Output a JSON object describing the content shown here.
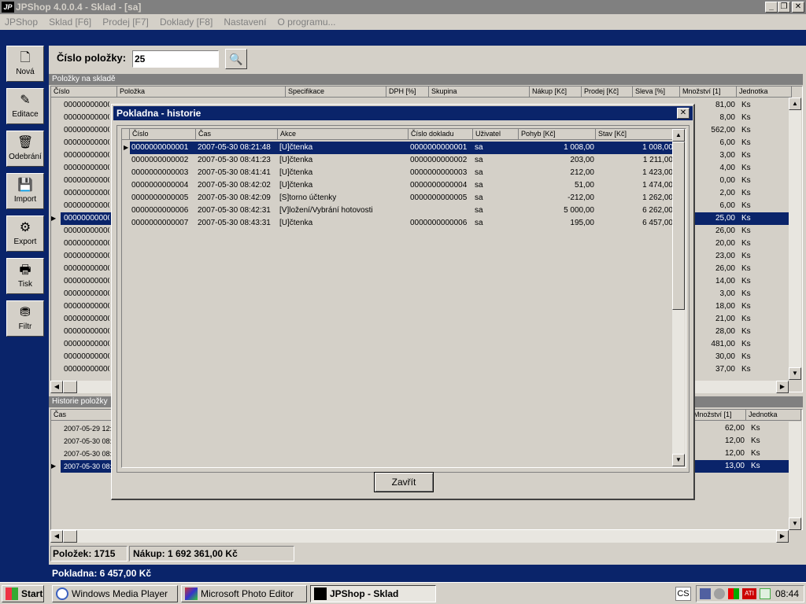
{
  "window": {
    "logo": "JP",
    "title": "JPShop 4.0.0.4 - Sklad - [sa]",
    "btn_minimize": "_",
    "btn_maximize": "❐",
    "btn_close": "✕"
  },
  "menu": [
    "JPShop",
    "Sklad [F6]",
    "Prodej [F7]",
    "Doklady [F8]",
    "Nastavení",
    "O programu..."
  ],
  "toolbar": [
    {
      "label": "Nová",
      "icon": "🗋"
    },
    {
      "label": "Editace",
      "icon": "✎"
    },
    {
      "label": "Odebrání",
      "icon": "🗑"
    },
    {
      "label": "Import",
      "icon": "💾"
    },
    {
      "label": "Export",
      "icon": "⚙"
    },
    {
      "label": "Tisk",
      "icon": "🖶"
    },
    {
      "label": "Filtr",
      "icon": "⛃"
    }
  ],
  "search": {
    "label": "Číslo položky:",
    "value": "25"
  },
  "items_panel": {
    "title": "Položky na skladě",
    "columns": [
      "Číslo",
      "Položka",
      "Specifikace",
      "DPH [%]",
      "Skupina",
      "Nákup [Kč]",
      "Prodej [Kč]",
      "Sleva [%]",
      "Množství [1]",
      "Jednotka"
    ],
    "rows": [
      {
        "cislo": "00000000000",
        "mnozstvi": "81,00",
        "jednotka": "Ks"
      },
      {
        "cislo": "00000000000",
        "mnozstvi": "8,00",
        "jednotka": "Ks"
      },
      {
        "cislo": "00000000000",
        "mnozstvi": "562,00",
        "jednotka": "Ks"
      },
      {
        "cislo": "00000000000",
        "mnozstvi": "6,00",
        "jednotka": "Ks"
      },
      {
        "cislo": "00000000000",
        "mnozstvi": "3,00",
        "jednotka": "Ks"
      },
      {
        "cislo": "00000000000",
        "mnozstvi": "4,00",
        "jednotka": "Ks"
      },
      {
        "cislo": "00000000000",
        "mnozstvi": "0,00",
        "jednotka": "Ks"
      },
      {
        "cislo": "00000000000",
        "mnozstvi": "2,00",
        "jednotka": "Ks"
      },
      {
        "cislo": "00000000000",
        "mnozstvi": "6,00",
        "jednotka": "Ks"
      },
      {
        "cislo": "00000000000",
        "mnozstvi": "25,00",
        "jednotka": "Ks",
        "selected": true
      },
      {
        "cislo": "00000000000",
        "mnozstvi": "26,00",
        "jednotka": "Ks"
      },
      {
        "cislo": "00000000000",
        "mnozstvi": "20,00",
        "jednotka": "Ks"
      },
      {
        "cislo": "00000000000",
        "mnozstvi": "23,00",
        "jednotka": "Ks"
      },
      {
        "cislo": "00000000000",
        "mnozstvi": "26,00",
        "jednotka": "Ks"
      },
      {
        "cislo": "00000000000",
        "mnozstvi": "14,00",
        "jednotka": "Ks"
      },
      {
        "cislo": "00000000000",
        "mnozstvi": "3,00",
        "jednotka": "Ks"
      },
      {
        "cislo": "00000000000",
        "mnozstvi": "18,00",
        "jednotka": "Ks"
      },
      {
        "cislo": "00000000000",
        "mnozstvi": "21,00",
        "jednotka": "Ks"
      },
      {
        "cislo": "00000000000",
        "mnozstvi": "28,00",
        "jednotka": "Ks"
      },
      {
        "cislo": "00000000000",
        "mnozstvi": "481,00",
        "jednotka": "Ks"
      },
      {
        "cislo": "00000000000",
        "mnozstvi": "30,00",
        "jednotka": "Ks"
      },
      {
        "cislo": "00000000000",
        "mnozstvi": "37,00",
        "jednotka": "Ks"
      }
    ]
  },
  "history_panel": {
    "title": "Historie položky",
    "columns": [
      "Čas",
      "Množství [1]",
      "Jednotka"
    ],
    "rows": [
      {
        "cas": "2007-05-29 12:",
        "mnozstvi": "62,00",
        "jednotka": "Ks"
      },
      {
        "cas": "2007-05-30 08:",
        "mnozstvi": "12,00",
        "jednotka": "Ks"
      },
      {
        "cas": "2007-05-30 08:",
        "mnozstvi": "12,00",
        "jednotka": "Ks"
      },
      {
        "cas": "2007-05-30 08:",
        "mnozstvi": "13,00",
        "jednotka": "Ks",
        "selected": true
      }
    ]
  },
  "status": {
    "polozek": "Položek: 1715",
    "nakup": "Nákup: 1 692 361,00 Kč",
    "pokladna": "Pokladna: 6 457,00 Kč"
  },
  "dialog": {
    "title": "Pokladna - historie",
    "close": "✕",
    "columns": [
      "Číslo",
      "Čas",
      "Akce",
      "Číslo dokladu",
      "Uživatel",
      "Pohyb [Kč]",
      "Stav [Kč]"
    ],
    "rows": [
      {
        "cislo": "0000000000001",
        "cas": "2007-05-30 08:21:48",
        "akce": "[U]čtenka",
        "doklad": "0000000000001",
        "uzivatel": "sa",
        "pohyb": "1 008,00",
        "stav": "1 008,00",
        "selected": true
      },
      {
        "cislo": "0000000000002",
        "cas": "2007-05-30 08:41:23",
        "akce": "[U]čtenka",
        "doklad": "0000000000002",
        "uzivatel": "sa",
        "pohyb": "203,00",
        "stav": "1 211,00"
      },
      {
        "cislo": "0000000000003",
        "cas": "2007-05-30 08:41:41",
        "akce": "[U]čtenka",
        "doklad": "0000000000003",
        "uzivatel": "sa",
        "pohyb": "212,00",
        "stav": "1 423,00"
      },
      {
        "cislo": "0000000000004",
        "cas": "2007-05-30 08:42:02",
        "akce": "[U]čtenka",
        "doklad": "0000000000004",
        "uzivatel": "sa",
        "pohyb": "51,00",
        "stav": "1 474,00"
      },
      {
        "cislo": "0000000000005",
        "cas": "2007-05-30 08:42:09",
        "akce": "[S]torno účtenky",
        "doklad": "0000000000005",
        "uzivatel": "sa",
        "pohyb": "-212,00",
        "stav": "1 262,00"
      },
      {
        "cislo": "0000000000006",
        "cas": "2007-05-30 08:42:31",
        "akce": "[V]ložení/Vybrání hotovosti",
        "doklad": "",
        "uzivatel": "sa",
        "pohyb": "5 000,00",
        "stav": "6 262,00"
      },
      {
        "cislo": "0000000000007",
        "cas": "2007-05-30 08:43:31",
        "akce": "[U]čtenka",
        "doklad": "0000000000006",
        "uzivatel": "sa",
        "pohyb": "195,00",
        "stav": "6 457,00"
      }
    ],
    "button": "Zavřít"
  },
  "taskbar": {
    "start": "Start",
    "tasks": [
      "Windows Media Player",
      "Microsoft Photo Editor",
      "JPShop - Sklad"
    ],
    "lang": "CS",
    "clock": "08:44"
  }
}
